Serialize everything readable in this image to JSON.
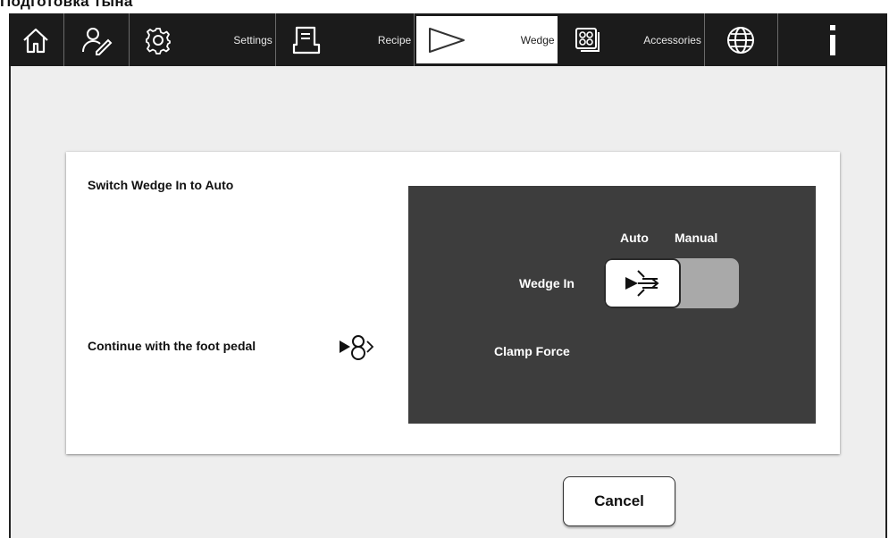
{
  "page": {
    "heading": "Подготовка тына"
  },
  "toolbar": {
    "items": [
      {
        "icon": "home-icon",
        "label": ""
      },
      {
        "icon": "user-edit-icon",
        "label": ""
      },
      {
        "icon": "gear-icon",
        "label": "Settings"
      },
      {
        "icon": "recipe-icon",
        "label": "Recipe"
      },
      {
        "icon": "wedge-icon",
        "label": "Wedge",
        "active": true
      },
      {
        "icon": "accessories-icon",
        "label": "Accessories"
      },
      {
        "icon": "globe-icon",
        "label": ""
      },
      {
        "icon": "info-icon",
        "label": ""
      }
    ]
  },
  "dialog": {
    "instruction": "Switch Wedge In to Auto",
    "continue_text": "Continue with the foot pedal",
    "pedal_icon": "foot-pedal-icon",
    "control_panel": {
      "auto_label": "Auto",
      "manual_label": "Manual",
      "wedge_in_label": "Wedge In",
      "wedge_in_state": "Auto",
      "clamp_force_label": "Clamp Force"
    }
  },
  "buttons": {
    "cancel_label": "Cancel"
  },
  "colors": {
    "toolbar_bg": "#1b1b1b",
    "panel_dark": "#3d3d3d",
    "toggle_off": "#a9a9a9"
  }
}
